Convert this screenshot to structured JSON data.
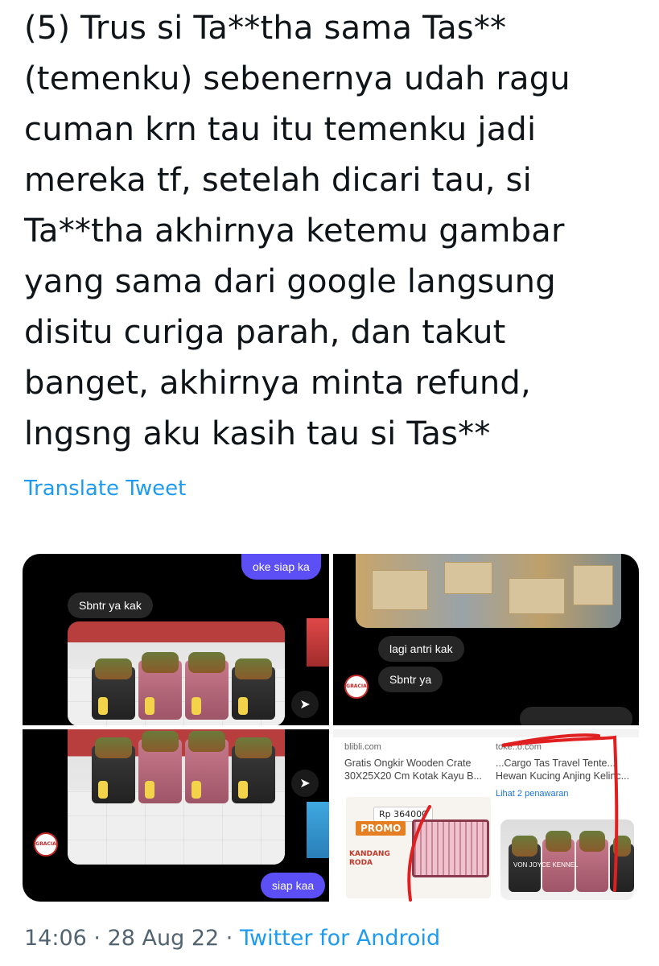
{
  "tweet": {
    "lines": [
      "(5) Trus si Ta**tha sama Tas**",
      "(temenku) sebenernya udah ragu",
      "cuman krn tau itu temenku jadi",
      "mereka tf, setelah dicari tau, si",
      "Ta**tha akhirnya ketemu gambar",
      "yang sama dari google langsung",
      "disitu curiga parah, dan takut",
      "banget, akhirnya minta refund,",
      "lngsng aku kasih tau si Tas**"
    ],
    "translate_label": "Translate Tweet",
    "time": "14:06",
    "date": "28 Aug 22",
    "separator": "·",
    "source": "Twitter for Android"
  },
  "media": {
    "chat1": {
      "outgoing": "oke siap ka",
      "incoming": "Sbntr ya kak"
    },
    "chat2": {
      "incoming_1": "lagi antri kak",
      "incoming_2": "Sbntr ya"
    },
    "chat3": {
      "outgoing": "siap kaa"
    },
    "shop": {
      "left_source": "blibli.com",
      "left_title_1": "Gratis Ongkir Wooden Crate",
      "left_title_2": "30X25X20 Cm Kotak Kayu B...",
      "price": "Rp 364000",
      "promo": "PROMO",
      "kandang": "KANDANG",
      "roda": "RODA",
      "right_source": "toke..o.com",
      "right_title_1": "...Cargo Tas Travel Tente...",
      "right_title_2": "Hewan Kucing Anjing Kelinc...",
      "offers": "Lihat 2 penawaran",
      "kennel": "VON JOYCE KENNEL"
    },
    "avatar_text": "GRACIA"
  },
  "colors": {
    "link": "#1d9bf0",
    "meta": "#536471",
    "outgoing_bubble": "#5b4ff5",
    "incoming_bubble": "#262626"
  }
}
